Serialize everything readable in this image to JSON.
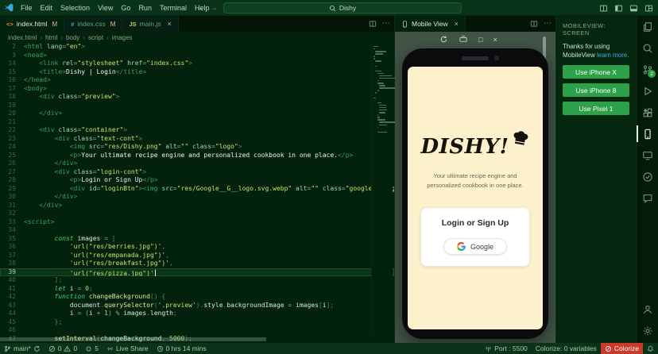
{
  "icons": {
    "close": "×",
    "breadcrumb_chevron": "›",
    "back_arrow": "←",
    "forward_arrow": "→",
    "more_actions": "⋯",
    "fit_square": "□"
  },
  "titlebar": {
    "menus": [
      "File",
      "Edit",
      "Selection",
      "View",
      "Go",
      "Run",
      "Terminal",
      "Help"
    ],
    "search_text": "Dishy"
  },
  "tabs": [
    {
      "icon": "<>",
      "label": "index.html",
      "badge": "M"
    },
    {
      "icon": "#",
      "label": "index.css",
      "badge": "M"
    },
    {
      "icon": "JS",
      "label": "main.js",
      "badge": ""
    }
  ],
  "breadcrumb": [
    "index.html",
    "html",
    "body",
    "script",
    "images"
  ],
  "panel": {
    "tab_label": "Mobile View"
  },
  "editor": {
    "lines": [
      {
        "n": "2",
        "s": [
          [
            "p",
            "<"
          ],
          [
            "t",
            "html"
          ],
          [
            "a",
            " lang"
          ],
          [
            "o",
            "="
          ],
          [
            "s",
            "\"en\""
          ],
          [
            "p",
            ">"
          ]
        ]
      },
      {
        "n": "3",
        "s": [
          [
            "p",
            "<"
          ],
          [
            "t",
            "head"
          ],
          [
            "p",
            ">"
          ]
        ]
      },
      {
        "n": "14",
        "s": [
          [
            "p",
            "    <"
          ],
          [
            "t",
            "link"
          ],
          [
            "a",
            " rel"
          ],
          [
            "o",
            "="
          ],
          [
            "s",
            "\"stylesheet\""
          ],
          [
            "a",
            " href"
          ],
          [
            "o",
            "="
          ],
          [
            "s",
            "\"index.css\""
          ],
          [
            "p",
            ">"
          ]
        ]
      },
      {
        "n": "15",
        "s": [
          [
            "p",
            "    <"
          ],
          [
            "t",
            "title"
          ],
          [
            "p",
            ">"
          ],
          [
            "x",
            "Dishy | Login"
          ],
          [
            "p",
            "</"
          ],
          [
            "t",
            "title"
          ],
          [
            "p",
            ">"
          ]
        ]
      },
      {
        "n": "16",
        "s": [
          [
            "p",
            "</"
          ],
          [
            "t",
            "head"
          ],
          [
            "p",
            ">"
          ]
        ]
      },
      {
        "n": "17",
        "s": [
          [
            "p",
            "<"
          ],
          [
            "t",
            "body"
          ],
          [
            "p",
            ">"
          ]
        ]
      },
      {
        "n": "18",
        "s": [
          [
            "p",
            "    <"
          ],
          [
            "t",
            "div"
          ],
          [
            "a",
            " class"
          ],
          [
            "o",
            "="
          ],
          [
            "s",
            "\"preview\""
          ],
          [
            "p",
            ">"
          ]
        ]
      },
      {
        "n": "19",
        "s": []
      },
      {
        "n": "20",
        "s": [
          [
            "p",
            "    </"
          ],
          [
            "t",
            "div"
          ],
          [
            "p",
            ">"
          ]
        ]
      },
      {
        "n": "21",
        "s": []
      },
      {
        "n": "22",
        "s": [
          [
            "p",
            "    <"
          ],
          [
            "t",
            "div"
          ],
          [
            "a",
            " class"
          ],
          [
            "o",
            "="
          ],
          [
            "s",
            "\"container\""
          ],
          [
            "p",
            ">"
          ]
        ]
      },
      {
        "n": "23",
        "s": [
          [
            "p",
            "        <"
          ],
          [
            "t",
            "div"
          ],
          [
            "a",
            " class"
          ],
          [
            "o",
            "="
          ],
          [
            "s",
            "\"text-cont\""
          ],
          [
            "p",
            ">"
          ]
        ]
      },
      {
        "n": "24",
        "s": [
          [
            "p",
            "            <"
          ],
          [
            "t",
            "img"
          ],
          [
            "a",
            " src"
          ],
          [
            "o",
            "="
          ],
          [
            "s",
            "\"res/Dishy.png\""
          ],
          [
            "a",
            " alt"
          ],
          [
            "o",
            "="
          ],
          [
            "s",
            "\"\""
          ],
          [
            "a",
            " class"
          ],
          [
            "o",
            "="
          ],
          [
            "s",
            "\"logo\""
          ],
          [
            "p",
            ">"
          ]
        ]
      },
      {
        "n": "25",
        "s": [
          [
            "p",
            "            <"
          ],
          [
            "t",
            "p"
          ],
          [
            "p",
            ">"
          ],
          [
            "x",
            "Your ultimate recipe engine and personalized cookbook in one place."
          ],
          [
            "p",
            "</"
          ],
          [
            "t",
            "p"
          ],
          [
            "p",
            ">"
          ]
        ]
      },
      {
        "n": "26",
        "s": [
          [
            "p",
            "        </"
          ],
          [
            "t",
            "div"
          ],
          [
            "p",
            ">"
          ]
        ]
      },
      {
        "n": "27",
        "s": [
          [
            "p",
            "        <"
          ],
          [
            "t",
            "div"
          ],
          [
            "a",
            " class"
          ],
          [
            "o",
            "="
          ],
          [
            "s",
            "\"login-cont\""
          ],
          [
            "p",
            ">"
          ]
        ]
      },
      {
        "n": "28",
        "s": [
          [
            "p",
            "            <"
          ],
          [
            "t",
            "p"
          ],
          [
            "p",
            ">"
          ],
          [
            "x",
            "Login or Sign Up"
          ],
          [
            "p",
            "</"
          ],
          [
            "t",
            "p"
          ],
          [
            "p",
            ">"
          ]
        ]
      },
      {
        "n": "29",
        "s": [
          [
            "p",
            "            <"
          ],
          [
            "t",
            "div"
          ],
          [
            "a",
            " id"
          ],
          [
            "o",
            "="
          ],
          [
            "s",
            "\"loginBtn\""
          ],
          [
            "p",
            "><"
          ],
          [
            "t",
            "img"
          ],
          [
            "a",
            " src"
          ],
          [
            "o",
            "="
          ],
          [
            "s",
            "\"res/Google__G__logo.svg.webp\""
          ],
          [
            "a",
            " alt"
          ],
          [
            "o",
            "="
          ],
          [
            "s",
            "\"\""
          ],
          [
            "a",
            " class"
          ],
          [
            "o",
            "="
          ],
          [
            "s",
            "\"google\""
          ],
          [
            "p",
            ">"
          ],
          [
            "x",
            "Google"
          ],
          [
            "p",
            "</"
          ],
          [
            "t",
            "div"
          ],
          [
            "p",
            ">"
          ]
        ]
      },
      {
        "n": "30",
        "s": [
          [
            "p",
            "        </"
          ],
          [
            "t",
            "div"
          ],
          [
            "p",
            ">"
          ]
        ]
      },
      {
        "n": "31",
        "s": [
          [
            "p",
            "    </"
          ],
          [
            "t",
            "div"
          ],
          [
            "p",
            ">"
          ]
        ]
      },
      {
        "n": "32",
        "s": []
      },
      {
        "n": "33",
        "s": [
          [
            "p",
            "<"
          ],
          [
            "t",
            "script"
          ],
          [
            "p",
            ">"
          ]
        ]
      },
      {
        "n": "34",
        "s": []
      },
      {
        "n": "35",
        "s": [
          [
            "p",
            "        "
          ],
          [
            "k",
            "const"
          ],
          [
            "v",
            " images "
          ],
          [
            "o",
            "= "
          ],
          [
            "p",
            "["
          ]
        ]
      },
      {
        "n": "36",
        "s": [
          [
            "p",
            "            "
          ],
          [
            "s",
            "'url(\"res/berries.jpg\")'"
          ],
          [
            "p",
            ","
          ]
        ]
      },
      {
        "n": "37",
        "s": [
          [
            "p",
            "            "
          ],
          [
            "s",
            "'url(\"res/empanada.jpg\")'"
          ],
          [
            "p",
            ","
          ]
        ]
      },
      {
        "n": "38",
        "s": [
          [
            "p",
            "            "
          ],
          [
            "s",
            "'url(\"res/breakfast.jpg\")'"
          ],
          [
            "p",
            ","
          ]
        ]
      },
      {
        "n": "39",
        "cur": true,
        "s": [
          [
            "p",
            "            "
          ],
          [
            "s",
            "'url(\"res/pizza.jpg\")'"
          ]
        ]
      },
      {
        "n": "40",
        "s": [
          [
            "p",
            "        ];"
          ]
        ]
      },
      {
        "n": "41",
        "s": [
          [
            "p",
            "        "
          ],
          [
            "k",
            "let"
          ],
          [
            "v",
            " i "
          ],
          [
            "o",
            "= "
          ],
          [
            "n",
            "0"
          ],
          [
            "p",
            ";"
          ]
        ]
      },
      {
        "n": "42",
        "s": [
          [
            "p",
            "        "
          ],
          [
            "k",
            "function"
          ],
          [
            "f",
            " changeBackground"
          ],
          [
            "p",
            "() {"
          ]
        ]
      },
      {
        "n": "43",
        "s": [
          [
            "p",
            "            "
          ],
          [
            "v",
            "document"
          ],
          [
            "p",
            "."
          ],
          [
            "f",
            "querySelector"
          ],
          [
            "p",
            "("
          ],
          [
            "s",
            "'.preview'"
          ],
          [
            "p",
            ")."
          ],
          [
            "v",
            "style"
          ],
          [
            "p",
            "."
          ],
          [
            "v",
            "backgroundImage"
          ],
          [
            "o",
            " = "
          ],
          [
            "v",
            "images"
          ],
          [
            "p",
            "["
          ],
          [
            "v",
            "i"
          ],
          [
            "p",
            "];"
          ]
        ]
      },
      {
        "n": "44",
        "s": [
          [
            "p",
            "            "
          ],
          [
            "v",
            "i"
          ],
          [
            "o",
            " = ("
          ],
          [
            "v",
            "i"
          ],
          [
            "o",
            " + "
          ],
          [
            "n",
            "1"
          ],
          [
            "o",
            ") % "
          ],
          [
            "v",
            "images"
          ],
          [
            "p",
            "."
          ],
          [
            "v",
            "length"
          ],
          [
            "p",
            ";"
          ]
        ]
      },
      {
        "n": "45",
        "s": [
          [
            "p",
            "        };"
          ]
        ]
      },
      {
        "n": "46",
        "s": []
      },
      {
        "n": "47",
        "s": [
          [
            "p",
            "        "
          ],
          [
            "f",
            "setInterval"
          ],
          [
            "p",
            "("
          ],
          [
            "v",
            "changeBackground"
          ],
          [
            "p",
            ", "
          ],
          [
            "n",
            "5000"
          ],
          [
            "p",
            ");"
          ]
        ]
      }
    ]
  },
  "phone": {
    "logo": "DISHY!",
    "tagline": "Your ultimate recipe engine and personalized cookbook in one place.",
    "login_title": "Login or Sign Up",
    "google_label": "Google"
  },
  "sidebar": {
    "title": "MOBILEVIEW: SCREEN",
    "thanks": "Thanks for using MobileView ",
    "link": "learn more.",
    "buttons": [
      "Use iPhone X",
      "Use iPhone 8",
      "Use Pixel 1"
    ]
  },
  "activitybar": {
    "scm_badge": "2"
  },
  "statusbar": {
    "branch": "main*",
    "errors": "0",
    "warnings": "0",
    "count": "5",
    "live_share": "Live Share",
    "time": "0 hrs 14 mins",
    "port": "Port : 5500",
    "colorize_info": "Colorize: 0 variables",
    "colorize_label": "Colorize"
  },
  "colors": {
    "accent_green": "#2da04a",
    "modified_badge": "#e2c08d",
    "error_red": "#c93a2a",
    "screen_cream": "#fcf0cd"
  }
}
